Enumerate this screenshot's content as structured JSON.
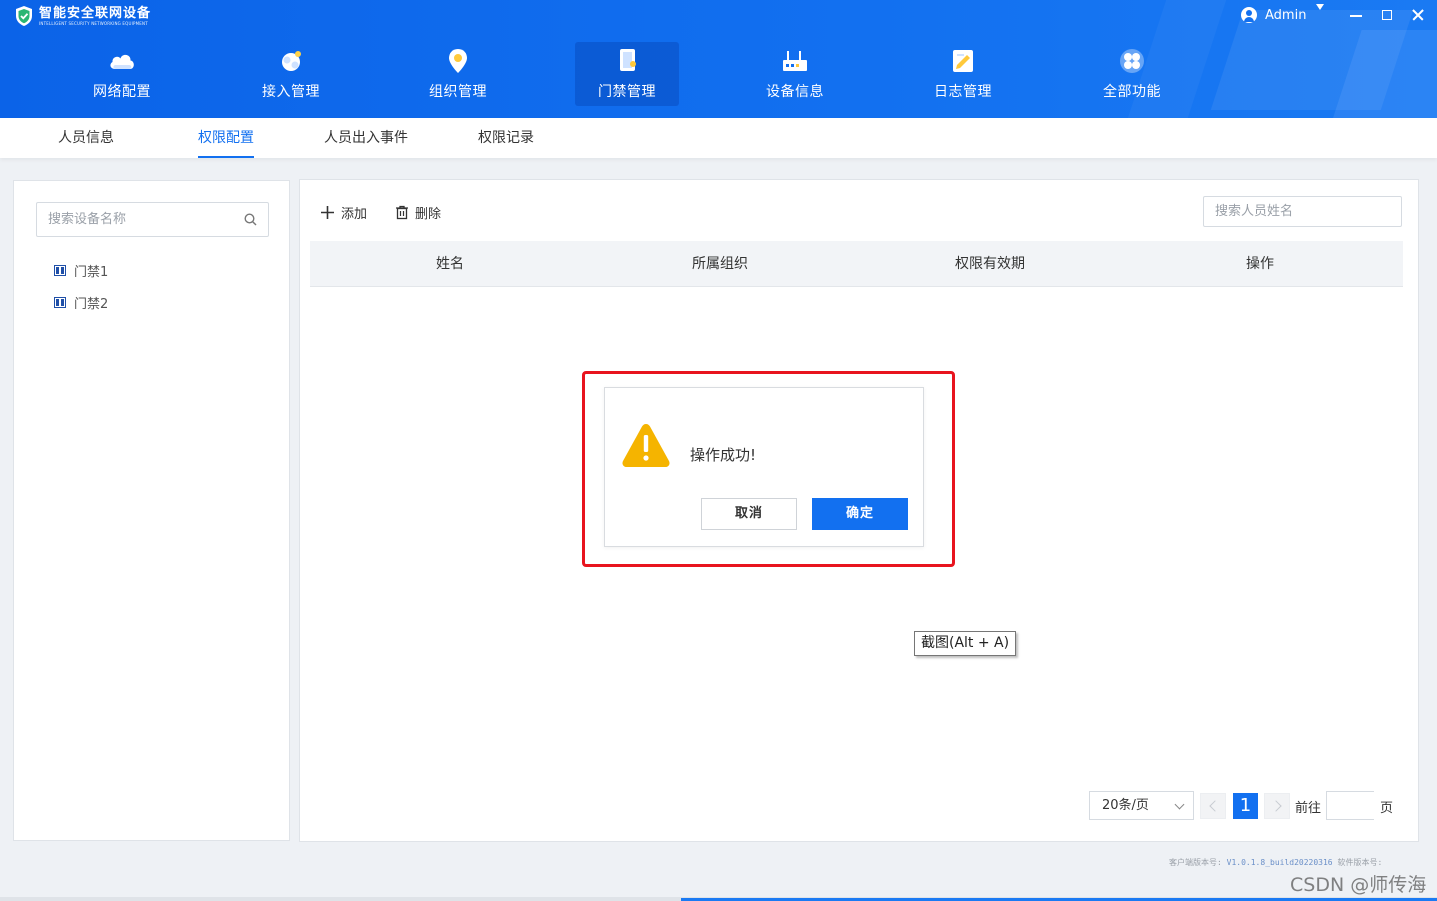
{
  "app": {
    "title": "智能安全联网设备",
    "subtitle": "INTELLIGENT SECURITY NETWORKING EQUIPMENT",
    "user": "Admin"
  },
  "nav": [
    {
      "label": "网络配置",
      "icon": "cloud-icon",
      "active": false
    },
    {
      "label": "接入管理",
      "icon": "access-icon",
      "active": false
    },
    {
      "label": "组织管理",
      "icon": "location-pin-icon",
      "active": false
    },
    {
      "label": "门禁管理",
      "icon": "door-access-icon",
      "active": true
    },
    {
      "label": "设备信息",
      "icon": "device-icon",
      "active": false
    },
    {
      "label": "日志管理",
      "icon": "log-icon",
      "active": false
    },
    {
      "label": "全部功能",
      "icon": "apps-icon",
      "active": false
    }
  ],
  "subtabs": [
    {
      "label": "人员信息",
      "active": false
    },
    {
      "label": "权限配置",
      "active": true
    },
    {
      "label": "人员出入事件",
      "active": false
    },
    {
      "label": "权限记录",
      "active": false
    }
  ],
  "left_panel": {
    "search_placeholder": "搜索设备名称",
    "devices": [
      "门禁1",
      "门禁2"
    ]
  },
  "toolbar": {
    "add_label": "添加",
    "delete_label": "删除",
    "search_placeholder": "搜索人员姓名"
  },
  "table": {
    "columns": [
      "姓名",
      "所属组织",
      "权限有效期",
      "操作"
    ],
    "rows": []
  },
  "pagination": {
    "page_size": "20条/页",
    "current_page": "1",
    "goto_label": "前往",
    "page_suffix": "页"
  },
  "dialog": {
    "message": "操作成功!",
    "cancel_label": "取消",
    "ok_label": "确定"
  },
  "tooltip": "截图(Alt + A)",
  "footer": {
    "client_version_label": "客户端版本号:",
    "client_version": "V1.0.1.8_build20220316",
    "software_version_label": "软件版本号:"
  },
  "watermark": "CSDN @师传海",
  "colors": {
    "primary": "#1270f0",
    "header": "#0b63e8",
    "highlight": "#e8141e",
    "warning": "#f5b400"
  }
}
